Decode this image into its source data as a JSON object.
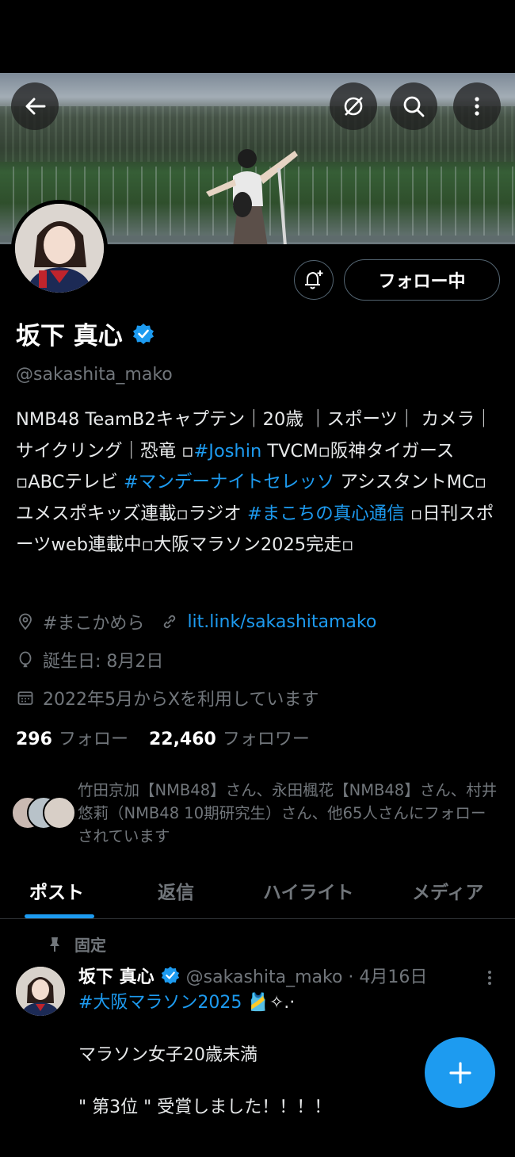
{
  "profile": {
    "name": "坂下 真心",
    "handle": "@sakashita_mako",
    "bio_parts": [
      {
        "text": "NMB48 TeamB2キャプテン｜20歳 ｜スポーツ｜ カメラ｜ サイクリング｜恐竜 ▫",
        "link": false
      },
      {
        "text": "#Joshin",
        "link": true
      },
      {
        "text": " TVCM▫阪神タイガース▫ABCテレビ ",
        "link": false
      },
      {
        "text": "#マンデーナイトセレッソ",
        "link": true
      },
      {
        "text": " アシスタントMC▫ユメスポキッズ連載▫ラジオ ",
        "link": false
      },
      {
        "text": "#まこちの真心通信",
        "link": true
      },
      {
        "text": " ▫日刊スポーツweb連載中▫大阪マラソン2025完走▫",
        "link": false
      }
    ],
    "location": "#まこかめら",
    "website": "lit.link/sakashitamako",
    "birthday": "誕生日: 8月2日",
    "joined": "2022年5月からXを利用しています",
    "following_count": "296",
    "following_label": "フォロー",
    "followers_count": "22,460",
    "followers_label": "フォロワー",
    "followed_by": "竹田京加【NMB48】さん、永田楓花【NMB48】さん、村井悠莉（NMB48 10期研究生）さん、他65人さんにフォローされています"
  },
  "actions": {
    "follow_label": "フォロー中"
  },
  "tabs": [
    {
      "label": "ポスト",
      "active": true
    },
    {
      "label": "返信",
      "active": false
    },
    {
      "label": "ハイライト",
      "active": false
    },
    {
      "label": "メディア",
      "active": false
    }
  ],
  "pinned_post": {
    "pinned_label": "固定",
    "author": "坂下 真心",
    "handle_date": "@sakashita_mako · 4月16日",
    "hashtag": "#大阪マラソン2025",
    "emoji": " 🎽✧.·",
    "line1": "マラソン女子20歳未満",
    "line2": "\" 第3位 \" 受賞しました！！！！"
  },
  "colors": {
    "accent": "#1d9bf0",
    "background": "#000000",
    "secondary_text": "#71767b"
  },
  "icons": [
    "back-arrow-icon",
    "grok-icon",
    "search-icon",
    "more-vertical-icon",
    "notification-bell-icon",
    "verified-badge-icon",
    "location-icon",
    "link-icon",
    "birthday-icon",
    "calendar-icon",
    "pin-icon",
    "compose-plus-icon"
  ]
}
